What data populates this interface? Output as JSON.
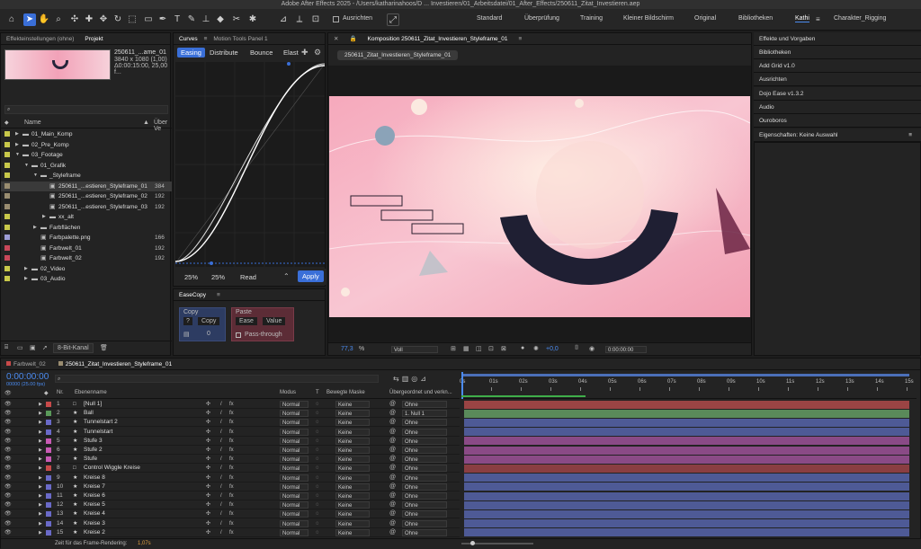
{
  "window_title": "Adobe After Effects 2025 - /Users/katharinahoos/D ... Investieren/01_Arbeitsdatei/01_After_Effects/250611_Zitat_Investieren.aep",
  "toolbar": {
    "align_label": "Ausrichten",
    "workspaces": [
      "Standard",
      "Überprüfung",
      "Training",
      "Kleiner Bildschirm",
      "Original",
      "Bibliotheken",
      "Kathi",
      "Charakter_Rigging"
    ]
  },
  "project": {
    "tabs": [
      "Effekteinstellungen (ohne)",
      "Projekt"
    ],
    "thumb_name": "250611_...ame_01",
    "thumb_size": "3840 x 1080 (1,00)",
    "thumb_dur": "Δ0:00:15:00, 25,00 f...",
    "search_placeholder": "",
    "col_name": "Name",
    "col_used": "Über Ve",
    "items": [
      {
        "label": "01_Main_Komp",
        "indent": 1,
        "color": "#c8c84a",
        "arrow": "▶",
        "val": ""
      },
      {
        "label": "02_Pre_Komp",
        "indent": 1,
        "color": "#c8c84a",
        "arrow": "▶",
        "val": ""
      },
      {
        "label": "03_Footage",
        "indent": 1,
        "color": "#c8c84a",
        "arrow": "▼",
        "val": ""
      },
      {
        "label": "01_Grafik",
        "indent": 2,
        "color": "#c8c84a",
        "arrow": "▼",
        "val": ""
      },
      {
        "label": "_Styleframe",
        "indent": 3,
        "color": "#c8c84a",
        "arrow": "▼",
        "val": ""
      },
      {
        "label": "250611_...estieren_Styleframe_01",
        "indent": 4,
        "color": "#9a8d70",
        "arrow": "",
        "val": "384"
      },
      {
        "label": "250611_...estieren_Styleframe_02",
        "indent": 4,
        "color": "#9a8d70",
        "arrow": "",
        "val": "192"
      },
      {
        "label": "250611_...estieren_Styleframe_03",
        "indent": 4,
        "color": "#9a8d70",
        "arrow": "",
        "val": "192"
      },
      {
        "label": "xx_alt",
        "indent": 4,
        "color": "#c8c84a",
        "arrow": "▶",
        "val": ""
      },
      {
        "label": "Farbflächen",
        "indent": 3,
        "color": "#c8c84a",
        "arrow": "▶",
        "val": ""
      },
      {
        "label": "Farbpalette.png",
        "indent": 3,
        "color": "#9d9dd6",
        "arrow": "",
        "val": "166"
      },
      {
        "label": "Farbwelt_01",
        "indent": 3,
        "color": "#c8485a",
        "arrow": "",
        "val": "192"
      },
      {
        "label": "Farbwelt_02",
        "indent": 3,
        "color": "#c8485a",
        "arrow": "",
        "val": "192"
      },
      {
        "label": "02_Video",
        "indent": 2,
        "color": "#c8c84a",
        "arrow": "▶",
        "val": ""
      },
      {
        "label": "03_Audio",
        "indent": 2,
        "color": "#c8c84a",
        "arrow": "▶",
        "val": ""
      }
    ],
    "bit_depth": "8-Bit-Kanal"
  },
  "curves": {
    "tabs": [
      "Curves",
      "Motion Tools Panel 1"
    ],
    "subtabs": [
      "Easing",
      "Distribute",
      "Bounce",
      "Elast"
    ],
    "in_val": "25%",
    "out_val": "25%",
    "read": "Read",
    "apply": "Apply"
  },
  "easecopy": {
    "title": "EaseCopy",
    "copy_head": "Copy",
    "copy_q": "?",
    "copy_btn": "Copy",
    "copy_count": "0",
    "paste_head": "Paste",
    "paste_ease": "Ease",
    "paste_value": "Value",
    "pass": "Pass-through"
  },
  "comp": {
    "tab": "Komposition 250611_Zitat_Investieren_Styleframe_01",
    "name_chip": "250611_Zitat_Investieren_Styleframe_01",
    "zoom": "77,3",
    "res": "Voll",
    "exposure": "+0,0",
    "time": "0:00:00:00"
  },
  "right_panels": [
    "Effekte und Vorgaben",
    "Bibliotheken",
    "Add Grid v1.0",
    "Ausrichten",
    "Dojo Ease v1.3.2",
    "Audio",
    "Ouroboros",
    "Eigenschaften: Keine Auswahl"
  ],
  "timeline": {
    "tabs": [
      "Farbwelt_02",
      "250611_Zitat_Investieren_Styleframe_01"
    ],
    "timecode": "0:00:00:00",
    "fps": "00000 (25.00 fps)",
    "headers": {
      "nr": "Nr.",
      "name": "Ebenenname",
      "mode": "Modus",
      "t": "T",
      "mask": "Bewegte Maske",
      "parent": "Übergeordnet und verkn..."
    },
    "ruler": [
      "0s",
      "01s",
      "02s",
      "03s",
      "04s",
      "05s",
      "06s",
      "07s",
      "08s",
      "09s",
      "10s",
      "11s",
      "12s",
      "13s",
      "14s",
      "15s"
    ],
    "layers": [
      {
        "n": "1",
        "name": "[Null 1]",
        "color": "#c84a4a",
        "mode": "Normal",
        "mask": "Keine",
        "parent": "Ohne",
        "bar": "#9a4444"
      },
      {
        "n": "2",
        "name": "Ball",
        "color": "#5a9a5a",
        "mode": "Normal",
        "mask": "Keine",
        "parent": "1. Null 1",
        "bar": "#5a8a5a"
      },
      {
        "n": "3",
        "name": "Tunnelstart 2",
        "color": "#6a6ac8",
        "mode": "Normal",
        "mask": "Keine",
        "parent": "Ohne",
        "bar": "#4e5a96"
      },
      {
        "n": "4",
        "name": "Tunnelstart",
        "color": "#6a6ac8",
        "mode": "Normal",
        "mask": "Keine",
        "parent": "Ohne",
        "bar": "#4e5a96"
      },
      {
        "n": "5",
        "name": "Stufe 3",
        "color": "#c85ab4",
        "mode": "Normal",
        "mask": "Keine",
        "parent": "Ohne",
        "bar": "#8a4a86"
      },
      {
        "n": "6",
        "name": "Stufe 2",
        "color": "#c85ab4",
        "mode": "Normal",
        "mask": "Keine",
        "parent": "Ohne",
        "bar": "#8a4a86"
      },
      {
        "n": "7",
        "name": "Stufe",
        "color": "#c85ab4",
        "mode": "Normal",
        "mask": "Keine",
        "parent": "Ohne",
        "bar": "#8a4a86"
      },
      {
        "n": "8",
        "name": "Control Wiggle Kreise",
        "color": "#c84a4a",
        "mode": "Normal",
        "mask": "Keine",
        "parent": "Ohne",
        "bar": "#8a3e42"
      },
      {
        "n": "9",
        "name": "Kreise 8",
        "color": "#6a6ac8",
        "mode": "Normal",
        "mask": "Keine",
        "parent": "Ohne",
        "bar": "#4e5a96"
      },
      {
        "n": "10",
        "name": "Kreise 7",
        "color": "#6a6ac8",
        "mode": "Normal",
        "mask": "Keine",
        "parent": "Ohne",
        "bar": "#4e5a96"
      },
      {
        "n": "11",
        "name": "Kreise 6",
        "color": "#6a6ac8",
        "mode": "Normal",
        "mask": "Keine",
        "parent": "Ohne",
        "bar": "#4e5a96"
      },
      {
        "n": "12",
        "name": "Kreise 5",
        "color": "#6a6ac8",
        "mode": "Normal",
        "mask": "Keine",
        "parent": "Ohne",
        "bar": "#4e5a96"
      },
      {
        "n": "13",
        "name": "Kreise 4",
        "color": "#6a6ac8",
        "mode": "Normal",
        "mask": "Keine",
        "parent": "Ohne",
        "bar": "#4e5a96"
      },
      {
        "n": "14",
        "name": "Kreise 3",
        "color": "#6a6ac8",
        "mode": "Normal",
        "mask": "Keine",
        "parent": "Ohne",
        "bar": "#4e5a96"
      },
      {
        "n": "15",
        "name": "Kreise 2",
        "color": "#6a6ac8",
        "mode": "Normal",
        "mask": "Keine",
        "parent": "Ohne",
        "bar": "#4e5a96"
      }
    ],
    "render_label": "Zeit für das Frame-Rendering:",
    "render_time": "1,07s"
  }
}
